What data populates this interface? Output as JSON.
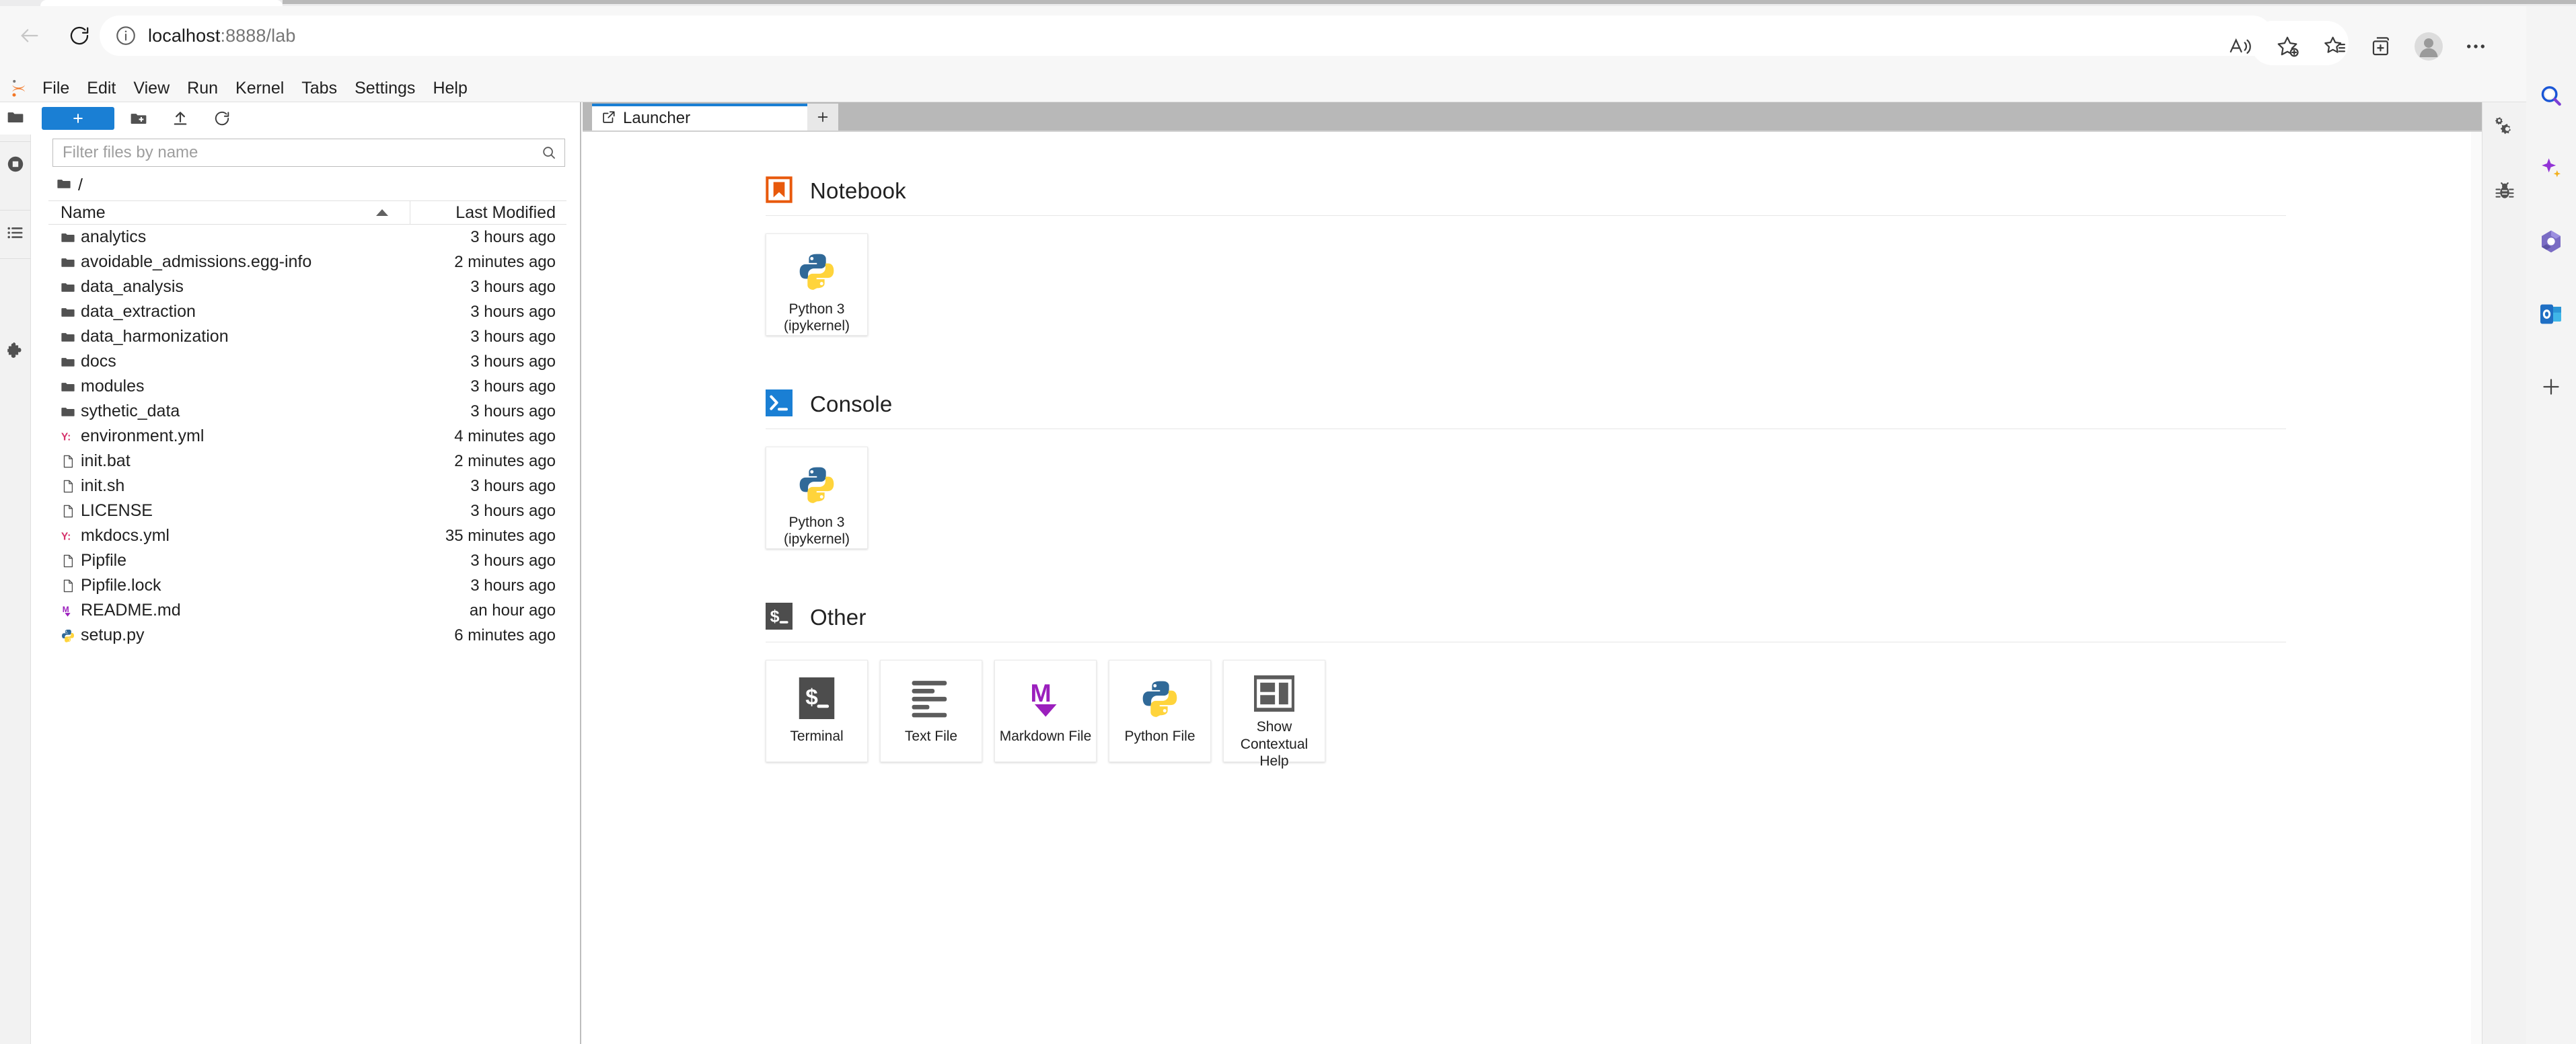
{
  "browser": {
    "back_label": "Back",
    "reload_label": "Refresh",
    "url": "localhost",
    "url_suffix": ":8888/lab",
    "site_info_label": "View site information",
    "actions": [
      {
        "name": "read-aloud-icon",
        "label": "Read aloud"
      },
      {
        "name": "add-favorite-icon",
        "label": "Add this page to favorites"
      },
      {
        "name": "favorites-icon",
        "label": "Favorites"
      },
      {
        "name": "collections-icon",
        "label": "Collections"
      },
      {
        "name": "profile-avatar",
        "label": "Profile"
      },
      {
        "name": "settings-and-more-icon",
        "label": "Settings and more"
      }
    ],
    "sidebar": [
      {
        "name": "search-icon",
        "label": "Search"
      },
      {
        "name": "copilot-icon",
        "label": "Copilot"
      },
      {
        "name": "microsoft365-icon",
        "label": "Microsoft 365"
      },
      {
        "name": "outlook-icon",
        "label": "Outlook"
      },
      {
        "name": "add-sidebar-icon",
        "label": "Customize"
      }
    ]
  },
  "jupyter": {
    "menubar": [
      "File",
      "Edit",
      "View",
      "Run",
      "Kernel",
      "Tabs",
      "Settings",
      "Help"
    ],
    "left_activity_bar": [
      {
        "name": "sidebar-item-file-browser",
        "icon": "folder-icon",
        "label": "File Browser",
        "active": true
      },
      {
        "name": "sidebar-item-running",
        "icon": "running-terminals-icon",
        "label": "Running Terminals and Kernels"
      },
      {
        "name": "sidebar-item-commands",
        "icon": "command-palette-icon",
        "label": "Commands"
      },
      {
        "name": "sidebar-item-extensions",
        "icon": "extension-manager-icon",
        "label": "Extension Manager"
      }
    ],
    "right_activity_bar": [
      {
        "name": "sidebar-item-property-inspector",
        "icon": "gear-icon",
        "label": "Property Inspector"
      },
      {
        "name": "sidebar-item-debugger",
        "icon": "bug-icon",
        "label": "Debugger"
      }
    ]
  },
  "file_browser": {
    "toolbar": {
      "new_launcher_label": "+",
      "new_folder_label": "New Folder",
      "upload_label": "Upload Files",
      "refresh_label": "Refresh File List"
    },
    "filter": {
      "value": "",
      "placeholder": "Filter files by name"
    },
    "breadcrumb": "/",
    "columns": {
      "name": "Name",
      "last_modified": "Last Modified"
    },
    "sort": "ascending",
    "items": [
      {
        "name": "analytics",
        "type": "folder",
        "modified": "3 hours ago"
      },
      {
        "name": "avoidable_admissions.egg-info",
        "type": "folder",
        "modified": "2 minutes ago"
      },
      {
        "name": "data_analysis",
        "type": "folder",
        "modified": "3 hours ago"
      },
      {
        "name": "data_extraction",
        "type": "folder",
        "modified": "3 hours ago"
      },
      {
        "name": "data_harmonization",
        "type": "folder",
        "modified": "3 hours ago"
      },
      {
        "name": "docs",
        "type": "folder",
        "modified": "3 hours ago"
      },
      {
        "name": "modules",
        "type": "folder",
        "modified": "3 hours ago"
      },
      {
        "name": "sythetic_data",
        "type": "folder",
        "modified": "3 hours ago"
      },
      {
        "name": "environment.yml",
        "type": "yaml",
        "modified": "4 minutes ago"
      },
      {
        "name": "init.bat",
        "type": "file",
        "modified": "2 minutes ago"
      },
      {
        "name": "init.sh",
        "type": "file",
        "modified": "3 hours ago"
      },
      {
        "name": "LICENSE",
        "type": "file",
        "modified": "3 hours ago"
      },
      {
        "name": "mkdocs.yml",
        "type": "yaml",
        "modified": "35 minutes ago"
      },
      {
        "name": "Pipfile",
        "type": "file",
        "modified": "3 hours ago"
      },
      {
        "name": "Pipfile.lock",
        "type": "file",
        "modified": "3 hours ago"
      },
      {
        "name": "README.md",
        "type": "markdown",
        "modified": "an hour ago"
      },
      {
        "name": "setup.py",
        "type": "python",
        "modified": "6 minutes ago"
      }
    ]
  },
  "main": {
    "tab": {
      "title": "Launcher",
      "icon": "launcher-icon"
    },
    "add_tab_label": "+",
    "launcher": {
      "sections": [
        {
          "title": "Notebook",
          "icon": "notebook-icon",
          "cards": [
            {
              "label": "Python 3\n(ipykernel)",
              "label_line1": "Python 3",
              "label_line2": "(ipykernel)",
              "icon": "python-logo-icon"
            }
          ]
        },
        {
          "title": "Console",
          "icon": "console-icon",
          "cards": [
            {
              "label": "Python 3\n(ipykernel)",
              "label_line1": "Python 3",
              "label_line2": "(ipykernel)",
              "icon": "python-logo-icon"
            }
          ]
        },
        {
          "title": "Other",
          "icon": "terminal-icon",
          "cards": [
            {
              "label": "Terminal",
              "label_line1": "Terminal",
              "label_line2": "",
              "icon": "terminal-icon"
            },
            {
              "label": "Text File",
              "label_line1": "Text File",
              "label_line2": "",
              "icon": "text-file-icon"
            },
            {
              "label": "Markdown File",
              "label_line1": "Markdown File",
              "label_line2": "",
              "icon": "markdown-icon"
            },
            {
              "label": "Python File",
              "label_line1": "Python File",
              "label_line2": "",
              "icon": "python-logo-icon"
            },
            {
              "label": "Show Contextual Help",
              "label_line1": "Show Contextual",
              "label_line2": "Help",
              "icon": "contextual-help-icon"
            }
          ]
        }
      ]
    }
  },
  "colors": {
    "jupyter_orange": "#E8590C",
    "accent_blue": "#1a7fd4",
    "console_blue": "#1a7fd4",
    "markdown_purple": "#9b1fbd",
    "yaml_red": "#d6336c",
    "python_blue": "#306998",
    "python_yellow": "#FFD43B",
    "terminal_dark": "#4d4d4d"
  }
}
